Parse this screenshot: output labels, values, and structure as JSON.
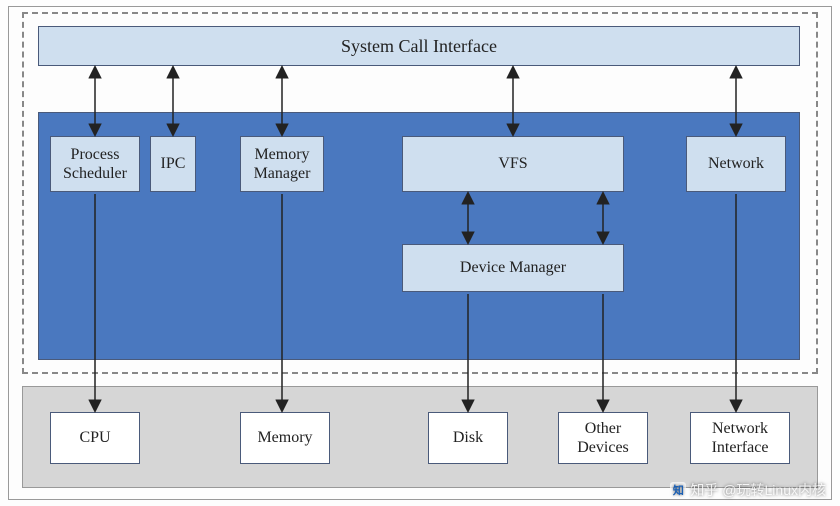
{
  "title": "System Call Interface",
  "kernel": {
    "process_scheduler": "Process\nScheduler",
    "ipc": "IPC",
    "memory_manager": "Memory\nManager",
    "vfs": "VFS",
    "network": "Network",
    "device_manager": "Device Manager"
  },
  "hardware": {
    "cpu": "CPU",
    "memory": "Memory",
    "disk": "Disk",
    "other_devices": "Other\nDevices",
    "network_interface": "Network\nInterface"
  },
  "watermark": "知乎 @玩转Linux内核"
}
